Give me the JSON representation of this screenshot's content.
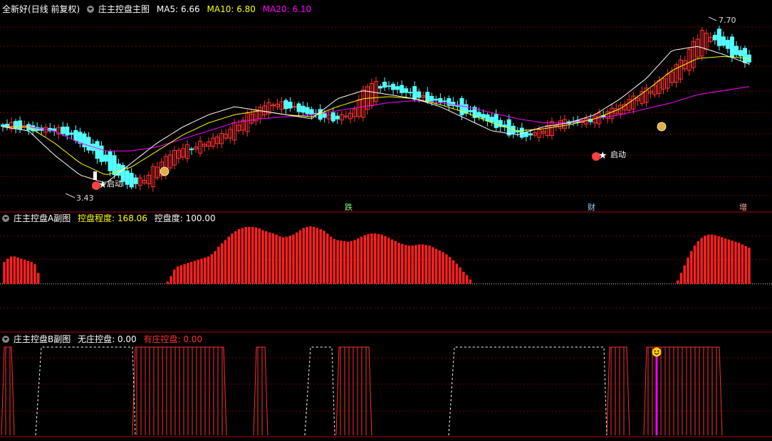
{
  "main_header": {
    "stock": "全新好",
    "period": "(日线 前复权)",
    "indicator": "庄主控盘主图",
    "ma5_label": "MA5:",
    "ma5": "6.66",
    "ma10_label": "MA10:",
    "ma10": "6.80",
    "ma20_label": "MA20:",
    "ma20": "6.10"
  },
  "sub_a_header": {
    "indicator": "庄主控盘A副图",
    "k1_label": "控盘程度:",
    "k1": "168.06",
    "k2_label": "控盘度:",
    "k2": "100.00"
  },
  "sub_b_header": {
    "indicator": "庄主控盘B副图",
    "k1_label": "无庄控盘:",
    "k1": "0.00",
    "k2_label": "有庄控盘:",
    "k2": "0.00"
  },
  "markers": {
    "high": "7.70",
    "low": "3.43",
    "start1": "启动",
    "start2": "启动",
    "ev1": "跌",
    "ev2": "财",
    "ev3": "增"
  },
  "colors": {
    "up": "#ff3232",
    "down": "#54ffff",
    "ma5": "#ffffff",
    "ma10": "#ffff00",
    "ma20": "#ff00ff",
    "grid": "#7a0000",
    "bar_a": "#ff2020",
    "bar_b": "#ff2020"
  },
  "chart_data": [
    {
      "type": "candlestick",
      "title": "庄主控盘主图",
      "price_range": [
        3.3,
        7.9
      ],
      "high_label": 7.7,
      "low_label": 3.43,
      "ma": {
        "MA5": 6.66,
        "MA10": 6.8,
        "MA20": 6.1
      },
      "ohlc_anchors": [
        [
          5.1,
          5.2,
          5.0,
          5.15
        ],
        [
          5.2,
          5.3,
          5.05,
          5.1
        ],
        [
          5.1,
          5.2,
          5.0,
          5.0
        ],
        [
          5.0,
          5.1,
          4.9,
          5.05
        ],
        [
          5.05,
          5.1,
          4.9,
          4.95
        ],
        [
          4.95,
          5.0,
          4.6,
          4.65
        ],
        [
          4.65,
          4.7,
          4.3,
          4.35
        ],
        [
          4.35,
          4.4,
          3.9,
          3.95
        ],
        [
          3.95,
          4.0,
          3.43,
          3.6
        ],
        [
          3.6,
          3.9,
          3.5,
          3.85
        ],
        [
          3.85,
          4.3,
          3.8,
          4.25
        ],
        [
          4.25,
          4.6,
          4.2,
          4.55
        ],
        [
          4.5,
          4.7,
          4.4,
          4.6
        ],
        [
          4.6,
          4.8,
          4.5,
          4.75
        ],
        [
          4.75,
          5.0,
          4.7,
          4.95
        ],
        [
          4.95,
          5.3,
          4.9,
          5.25
        ],
        [
          5.25,
          5.6,
          5.2,
          5.55
        ],
        [
          5.55,
          5.8,
          5.5,
          5.7
        ],
        [
          5.7,
          5.9,
          5.5,
          5.6
        ],
        [
          5.6,
          5.75,
          5.4,
          5.45
        ],
        [
          5.45,
          5.6,
          5.3,
          5.35
        ],
        [
          5.35,
          5.5,
          5.2,
          5.3
        ],
        [
          5.3,
          5.5,
          5.2,
          5.45
        ],
        [
          5.45,
          6.4,
          5.4,
          6.2
        ],
        [
          6.2,
          6.5,
          6.0,
          6.1
        ],
        [
          6.1,
          6.3,
          5.9,
          6.0
        ],
        [
          6.0,
          6.2,
          5.8,
          5.85
        ],
        [
          5.85,
          6.0,
          5.7,
          5.75
        ],
        [
          5.75,
          5.9,
          5.6,
          5.7
        ],
        [
          5.7,
          5.8,
          5.4,
          5.45
        ],
        [
          5.45,
          5.6,
          5.3,
          5.35
        ],
        [
          5.35,
          5.5,
          5.1,
          5.15
        ],
        [
          5.15,
          5.3,
          4.9,
          4.95
        ],
        [
          4.95,
          5.1,
          4.8,
          4.85
        ],
        [
          4.85,
          5.1,
          4.8,
          5.05
        ],
        [
          5.05,
          5.3,
          5.0,
          5.25
        ],
        [
          5.25,
          5.4,
          5.1,
          5.2
        ],
        [
          5.2,
          5.4,
          5.1,
          5.3
        ],
        [
          5.3,
          5.5,
          5.2,
          5.45
        ],
        [
          5.45,
          5.7,
          5.4,
          5.65
        ],
        [
          5.65,
          6.0,
          5.6,
          5.9
        ],
        [
          5.9,
          6.3,
          5.8,
          6.1
        ],
        [
          6.1,
          6.5,
          6.0,
          6.45
        ],
        [
          6.45,
          6.9,
          6.4,
          6.85
        ],
        [
          6.85,
          7.7,
          6.7,
          7.5
        ],
        [
          7.5,
          7.6,
          7.1,
          7.2
        ],
        [
          7.2,
          7.4,
          6.8,
          6.9
        ],
        [
          6.9,
          7.1,
          6.6,
          6.7
        ]
      ],
      "ma_anchors": {
        "MA5": [
          5.1,
          5.0,
          4.4,
          3.9,
          3.7,
          4.2,
          4.7,
          5.1,
          5.4,
          5.6,
          5.5,
          5.4,
          5.3,
          5.8,
          6.0,
          5.9,
          5.8,
          5.6,
          5.3,
          5.0,
          4.9,
          5.1,
          5.2,
          5.4,
          5.8,
          6.3,
          7.0,
          7.1,
          6.9,
          6.66
        ],
        "MA10": [
          5.1,
          5.1,
          4.7,
          4.2,
          3.9,
          4.1,
          4.5,
          4.9,
          5.2,
          5.4,
          5.5,
          5.4,
          5.35,
          5.6,
          5.8,
          5.85,
          5.8,
          5.65,
          5.45,
          5.2,
          5.0,
          5.05,
          5.15,
          5.3,
          5.55,
          6.0,
          6.5,
          6.8,
          6.85,
          6.8
        ],
        "MA20": [
          5.1,
          5.1,
          5.0,
          4.7,
          4.5,
          4.5,
          4.6,
          4.8,
          5.0,
          5.2,
          5.3,
          5.35,
          5.4,
          5.5,
          5.6,
          5.7,
          5.75,
          5.7,
          5.6,
          5.45,
          5.3,
          5.2,
          5.2,
          5.3,
          5.4,
          5.55,
          5.7,
          5.9,
          6.0,
          6.1
        ]
      }
    },
    {
      "type": "bar",
      "title": "庄主控盘A副图",
      "series": [
        {
          "name": "控盘程度",
          "value": 168.06
        },
        {
          "name": "控盘度",
          "value": 100.0
        }
      ],
      "values": [
        40,
        46,
        50,
        50,
        48,
        46,
        44,
        42,
        40,
        36,
        20,
        0,
        0,
        0,
        0,
        0,
        0,
        0,
        0,
        0,
        0,
        0,
        0,
        0,
        0,
        0,
        0,
        0,
        0,
        0,
        0,
        0,
        0,
        0,
        0,
        0,
        0,
        0,
        0,
        0,
        0,
        0,
        0,
        0,
        0,
        0,
        0,
        0,
        4,
        14,
        26,
        32,
        34,
        36,
        38,
        40,
        42,
        44,
        46,
        48,
        50,
        54,
        60,
        68,
        74,
        80,
        86,
        92,
        96,
        100,
        102,
        104,
        104,
        104,
        103,
        101,
        98,
        96,
        94,
        92,
        90,
        87,
        85,
        86,
        88,
        90,
        94,
        98,
        102,
        104,
        105,
        104,
        102,
        100,
        97,
        92,
        86,
        82,
        80,
        79,
        78,
        77,
        78,
        80,
        83,
        86,
        89,
        91,
        92,
        92,
        91,
        90,
        87,
        84,
        81,
        78,
        75,
        73,
        71,
        70,
        70,
        71,
        72,
        72,
        71,
        70,
        67,
        64,
        61,
        58,
        54,
        49,
        43,
        37,
        30,
        22,
        16,
        8,
        0,
        0,
        0,
        0,
        0,
        0,
        0,
        0,
        0,
        0,
        0,
        0,
        0,
        0,
        0,
        0,
        0,
        0,
        0,
        0,
        0,
        0,
        0,
        0,
        0,
        0,
        0,
        0,
        0,
        0,
        0,
        0,
        0,
        0,
        0,
        0,
        0,
        0,
        0,
        0,
        0,
        0,
        0,
        0,
        0,
        0,
        0,
        0,
        0,
        0,
        0,
        0,
        0,
        0,
        0,
        0,
        0,
        0,
        0,
        0,
        6,
        20,
        34,
        48,
        60,
        70,
        78,
        84,
        88,
        90,
        90,
        89,
        87,
        85,
        83,
        81,
        79,
        77,
        75,
        72,
        69,
        66
      ]
    },
    {
      "type": "area",
      "title": "庄主控盘B副图",
      "series": [
        {
          "name": "无庄控盘",
          "value": 0.0
        },
        {
          "name": "有庄控盘",
          "value": 0.0
        }
      ],
      "blocks_solid": [
        [
          2,
          20
        ],
        [
          186,
          318
        ],
        [
          356,
          376
        ],
        [
          472,
          522
        ],
        [
          852,
          884
        ],
        [
          904,
          1014
        ]
      ],
      "blocks_dashed": [
        [
          50,
          190
        ],
        [
          428,
          470
        ],
        [
          630,
          852
        ]
      ],
      "marker_x": 922
    }
  ]
}
